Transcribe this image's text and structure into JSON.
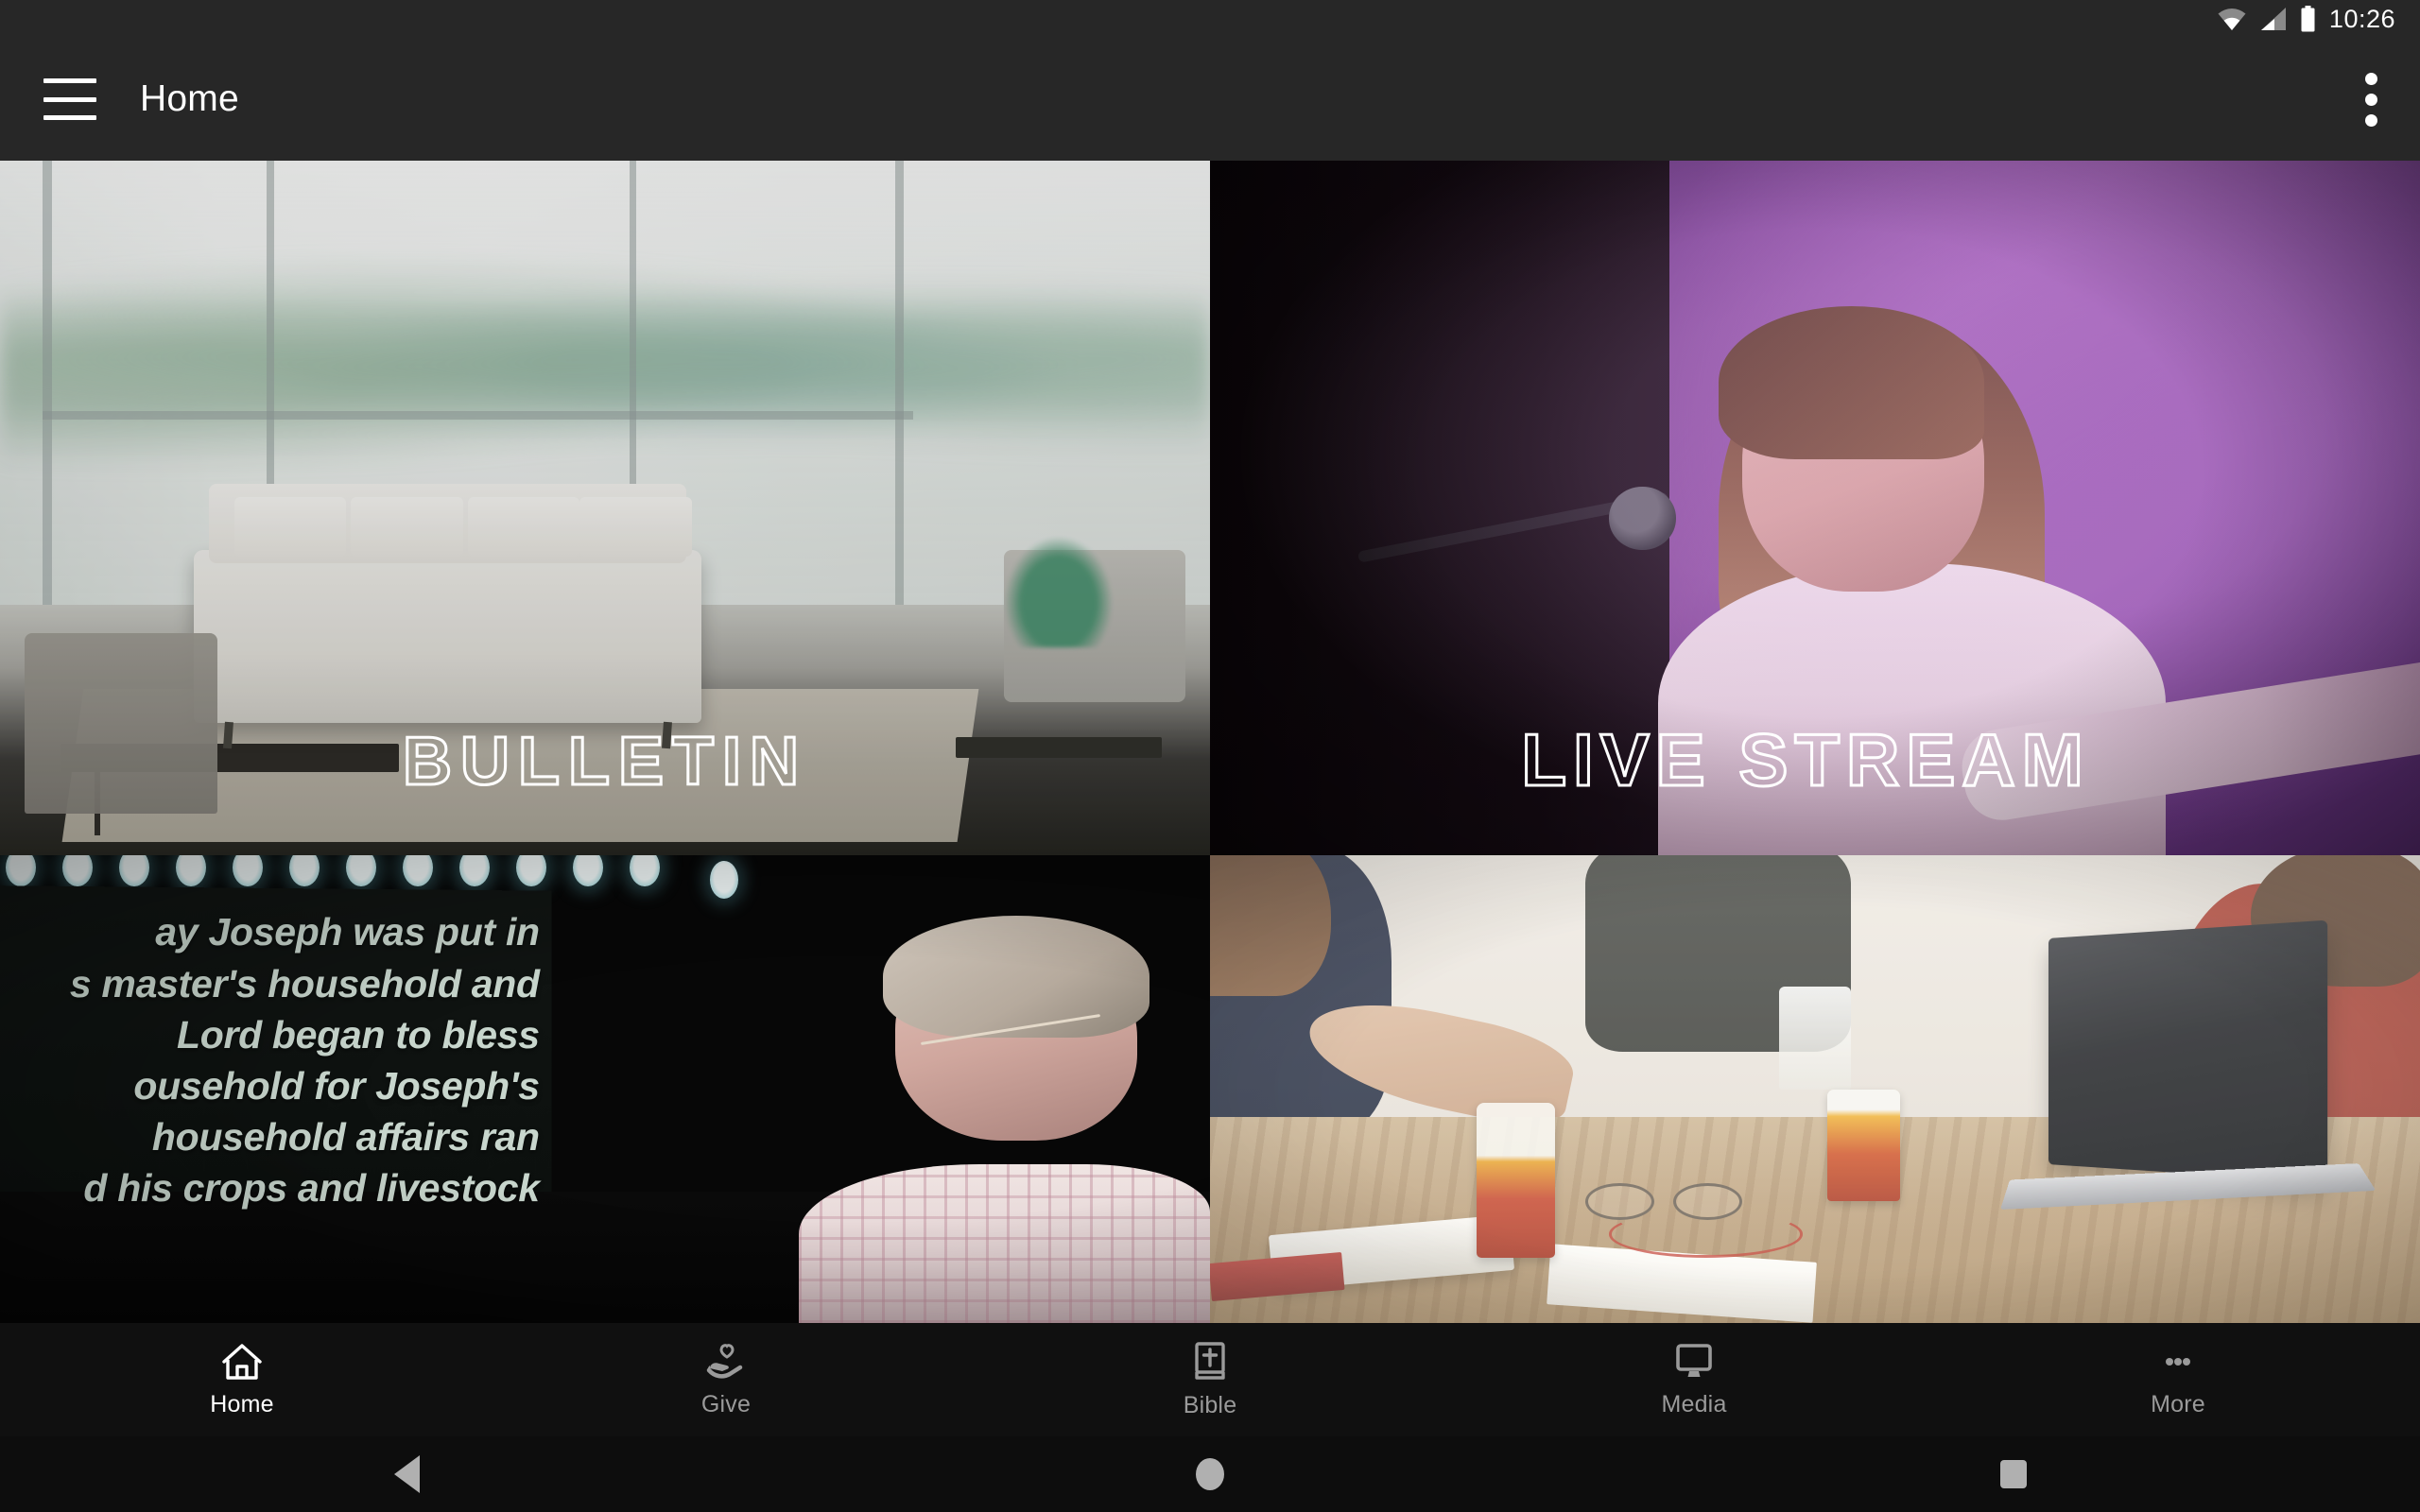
{
  "status_bar": {
    "time": "10:26",
    "icons": [
      "wifi-icon",
      "cellular-signal-icon",
      "battery-icon"
    ]
  },
  "app_bar": {
    "menu_icon": "hamburger-menu-icon",
    "title": "Home",
    "overflow_icon": "overflow-menu-icon"
  },
  "tiles": [
    {
      "id": "bulletin",
      "label": "BULLETIN",
      "image_description": "Bright church lobby with floor-to-ceiling windows, white tufted couch, armchairs and coffee table"
    },
    {
      "id": "live-stream",
      "label": "LIVE STREAM",
      "image_description": "Female worship singer at a microphone under purple stage lighting with arm outstretched"
    },
    {
      "id": "sermon",
      "label": "",
      "image_description": "Preacher with headset mic on a dark stage beside a projection screen showing a Bible verse slide",
      "slide_text": "ay Joseph was put in\ns master's household and\nLord began to bless\nousehold for Joseph's\nhousehold affairs ran\nd his crops and livestock"
    },
    {
      "id": "groups",
      "label": "",
      "image_description": "People gathered around a wooden table with laptops, notebooks, glasses and iced drinks"
    }
  ],
  "tab_bar": {
    "active_index": 0,
    "items": [
      {
        "label": "Home",
        "icon": "house-icon"
      },
      {
        "label": "Give",
        "icon": "hand-heart-icon"
      },
      {
        "label": "Bible",
        "icon": "book-cross-icon"
      },
      {
        "label": "Media",
        "icon": "monitor-icon"
      },
      {
        "label": "More",
        "icon": "ellipsis-icon"
      }
    ]
  },
  "system_nav": {
    "back": "back-triangle-icon",
    "home": "home-circle-icon",
    "recents": "recents-square-icon"
  },
  "colors": {
    "app_bar": "#272727",
    "tab_bar": "#101010",
    "nav_bar": "#0d0d0d",
    "active_tab": "#ffffff",
    "inactive_tab": "#9a9a9a"
  }
}
